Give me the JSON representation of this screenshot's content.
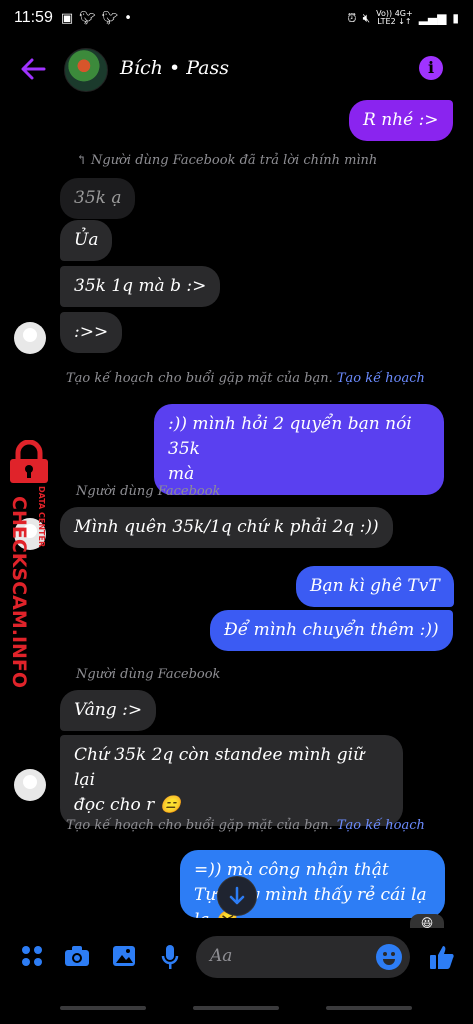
{
  "status": {
    "time": "11:59",
    "left_icons": [
      "image-icon",
      "twitter-icon",
      "twitter-icon",
      "dot"
    ],
    "net_top": "Vo)) 4G+",
    "net_bottom": "LTE2 ↓↑"
  },
  "header": {
    "name": "Bích • Pass"
  },
  "messages": [
    {
      "text": "R nhé :>"
    },
    {
      "text": "35k ạ"
    },
    {
      "text": "Ủa"
    },
    {
      "text": "35k 1q mà b :>"
    },
    {
      "text": ":>>"
    },
    {
      "line1": ":)) mình hỏi 2 quyển bạn nói 35k",
      "line2": "mà"
    },
    {
      "text": "Mình quên 35k/1q chứ k phải 2q :))"
    },
    {
      "text": "Bạn kì ghê TvT"
    },
    {
      "text": "Để mình chuyển thêm :))"
    },
    {
      "text": "Vâng :>"
    },
    {
      "line1": "Chứ 35k 2q còn standee mình giữ lại",
      "line2": "đọc cho r 😑"
    },
    {
      "line1": "=)) mà công nhận thật",
      "line2": "Tự thấy mình thấy rẻ cái lạ lạ 😆"
    }
  ],
  "meta": {
    "reply_note": "Người dùng Facebook đã trả lời chính mình",
    "plan_text": "Tạo kế hoạch cho buổi gặp mặt của bạn.",
    "plan_link": "Tạo kế hoạch",
    "sender1": "Người dùng Facebook",
    "sender2": "Người dùng Facebook"
  },
  "watermark": {
    "main": "CHECKSCAM.INFO",
    "sub": "DATA CENTER"
  },
  "composer": {
    "placeholder": "Aa"
  },
  "colors": {
    "accent_purple": "#a033ff",
    "bubble_in": "#2a2a2c",
    "bubble_out_purple": "#8a24ef",
    "bubble_out_blue": "#3b5bf3",
    "link_blue": "#2d7df5",
    "watermark_red": "#e0232a"
  }
}
